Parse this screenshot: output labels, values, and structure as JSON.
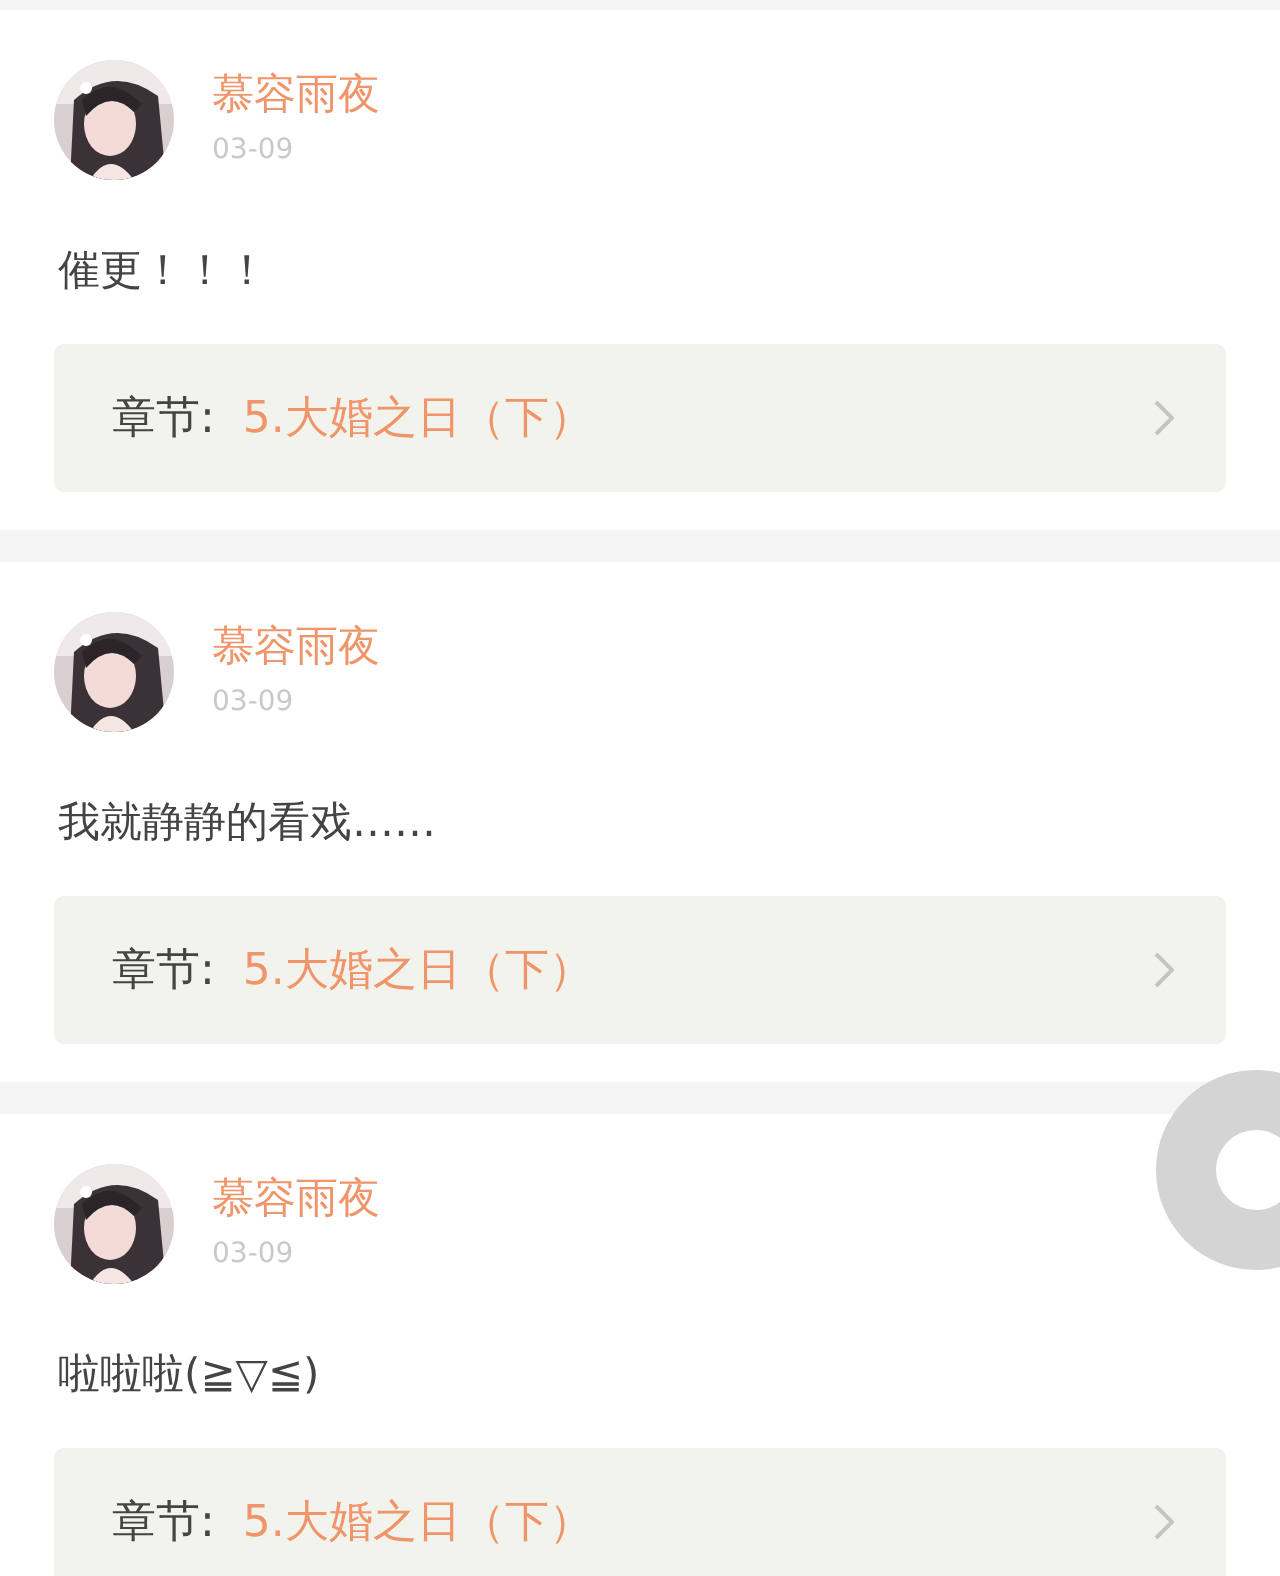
{
  "comments": [
    {
      "user": "慕容雨夜",
      "date": "03-09",
      "text": "催更！！！",
      "chapter_label": "章节:",
      "chapter_title": "5.大婚之日（下）"
    },
    {
      "user": "慕容雨夜",
      "date": "03-09",
      "text": "我就静静的看戏……",
      "chapter_label": "章节:",
      "chapter_title": "5.大婚之日（下）"
    },
    {
      "user": "慕容雨夜",
      "date": "03-09",
      "text": "啦啦啦(≧▽≦)",
      "chapter_label": "章节:",
      "chapter_title": "5.大婚之日（下）"
    }
  ]
}
